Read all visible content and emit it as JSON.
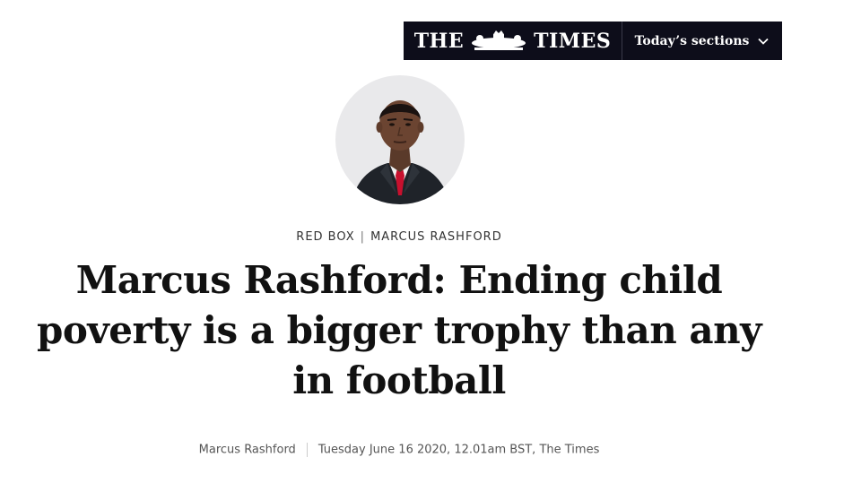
{
  "masthead": {
    "logo_left": "THE",
    "logo_right": "TIMES",
    "sections_label": "Today’s sections"
  },
  "article": {
    "kicker_section": "RED BOX",
    "kicker_separator": "|",
    "kicker_author": "MARCUS RASHFORD",
    "headline": "Marcus Rashford: Ending child poverty is a bigger trophy than any in football",
    "author": "Marcus Rashford",
    "dateline": "Tuesday June 16 2020, 12.01am BST, The Times"
  },
  "icons": {
    "crest": "royal-crest-icon",
    "chevron": "chevron-down-icon",
    "avatar": "author-portrait"
  },
  "colors": {
    "masthead_bg": "#0d0d1a",
    "tie": "#c8102e"
  }
}
